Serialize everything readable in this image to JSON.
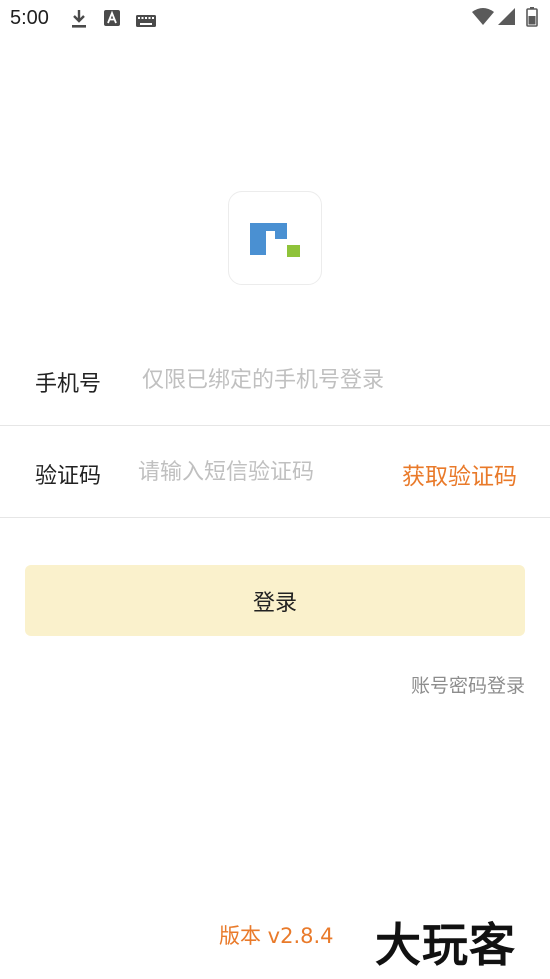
{
  "status_bar": {
    "time": "5:00",
    "icons": [
      "download-icon",
      "text-a-icon",
      "keyboard-icon",
      "wifi-icon",
      "signal-icon",
      "battery-icon"
    ]
  },
  "logo": {
    "colors": {
      "blue": "#4a90d2",
      "green": "#8fc33a"
    }
  },
  "form": {
    "phone": {
      "label": "手机号",
      "placeholder": "仅限已绑定的手机号登录",
      "value": ""
    },
    "code": {
      "label": "验证码",
      "placeholder": "请输入短信验证码",
      "value": "",
      "get_code_label": "获取验证码"
    }
  },
  "login_button_label": "登录",
  "account_password_login_label": "账号密码登录",
  "version_label": "版本 v2.8.4",
  "watermark_text": "大玩客",
  "colors": {
    "accent": "#e97a2a",
    "button_bg": "#faf1cc",
    "placeholder": "#c0c0c0",
    "secondary_text": "#8d8d8d"
  }
}
